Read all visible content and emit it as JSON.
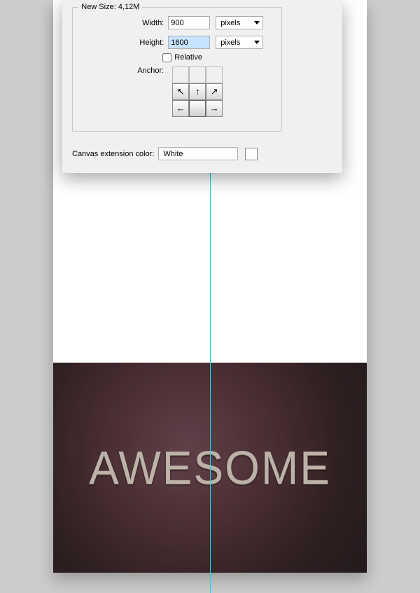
{
  "dialog": {
    "new_size_legend": "New Size: 4,12M",
    "width_label": "Width:",
    "width_value": "900",
    "height_label": "Height:",
    "height_value": "1600",
    "units_value": "pixels",
    "relative_label": "Relative",
    "anchor_label": "Anchor:",
    "ext_label": "Canvas extension color:",
    "ext_value": "White"
  },
  "canvas": {
    "text": "AWESOME"
  },
  "arrows": {
    "nw": "↖",
    "n": "↑",
    "ne": "↗",
    "w": "←",
    "e": "→"
  }
}
